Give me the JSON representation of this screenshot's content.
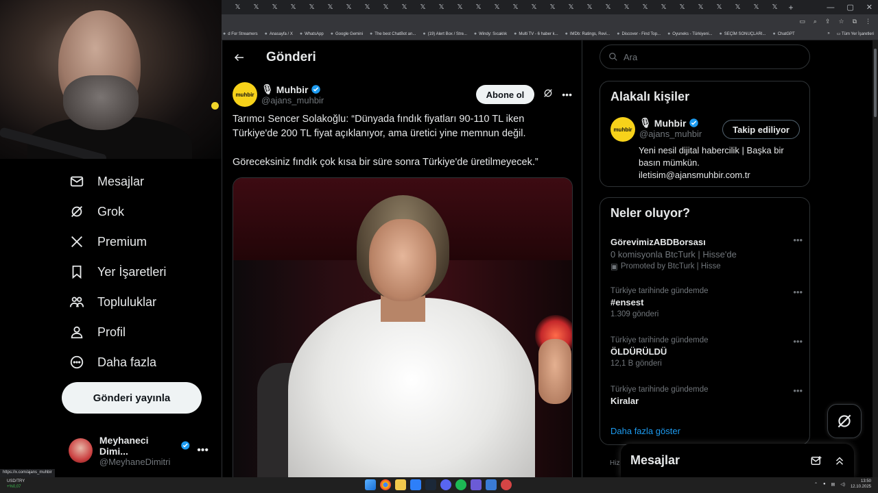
{
  "browser": {
    "tab_glyph": "𝕏",
    "new_tab": "+",
    "bookmarks": [
      "d For Streamers",
      "Anasayfa / X",
      "WhatsApp",
      "Google Gemini",
      "The best ChatBot an...",
      "(19) Alert Box / Stre...",
      "Windy: Sıcaklık",
      "Multi TV - 6 haber k...",
      "IMDb: Ratings, Revi...",
      "Discover - Find Top...",
      "Oyuneks - Türkiyeni...",
      "SEÇİM SONUÇLARI...",
      "ChatGPT"
    ],
    "bookmarks_more": "»",
    "bookmarks_all": "Tüm Yer İşaretleri",
    "status_url": "https://x.com/ajans_muhbir"
  },
  "nav": {
    "items": [
      {
        "label": "Mesajlar",
        "icon": "mail-icon"
      },
      {
        "label": "Grok",
        "icon": "grok-icon"
      },
      {
        "label": "Premium",
        "icon": "x-logo-icon"
      },
      {
        "label": "Yer İşaretleri",
        "icon": "bookmark-icon"
      },
      {
        "label": "Topluluklar",
        "icon": "communities-icon"
      },
      {
        "label": "Profil",
        "icon": "profile-icon"
      },
      {
        "label": "Daha fazla",
        "icon": "more-circle-icon"
      }
    ],
    "post_button": "Gönderi yayınla",
    "account": {
      "name": "Meyhaneci Dimi...",
      "handle": "@MeyhaneDimitri",
      "more": "•••"
    }
  },
  "main": {
    "title": "Gönderi",
    "tweet": {
      "avatar_text": "muhbir",
      "name": "Muhbir",
      "handle": "@ajans_muhbir",
      "subscribe": "Abone ol",
      "more": "•••",
      "paragraphs": [
        "Tarımcı Sencer Solakoğlu: “Dünyada fındık fiyatları 90-110 TL iken Türkiye'de 200 TL fiyat açıklanıyor, ama üretici yine memnun değil.",
        "Göreceksiniz fındık çok kısa bir süre sonra Türkiye'de üretilmeyecek.”"
      ]
    }
  },
  "sidebar": {
    "search_placeholder": "Ara",
    "related": {
      "title": "Alakalı kişiler",
      "name": "Muhbir",
      "avatar_text": "muhbir",
      "handle": "@ajans_muhbir",
      "follow": "Takip ediliyor",
      "bio": "Yeni nesil dijital habercilik | Başka bir basın mümkün. iletisim@ajansmuhbir.com.tr"
    },
    "trends": {
      "title": "Neler oluyor?",
      "items": [
        {
          "category": "",
          "name": "GörevimizABDBorsası",
          "sub": "0 komisyonla BtcTurk | Hisse'de",
          "promo": "Promoted by BtcTurk | Hisse",
          "count": ""
        },
        {
          "category": "Türkiye tarihinde gündemde",
          "name": "#ensest",
          "sub": "",
          "promo": "",
          "count": "1.309 gönderi"
        },
        {
          "category": "Türkiye tarihinde gündemde",
          "name": "ÖLDÜRÜLDÜ",
          "sub": "",
          "promo": "",
          "count": "12,1 B gönderi"
        },
        {
          "category": "Türkiye tarihinde gündemde",
          "name": "Kiralar",
          "sub": "",
          "promo": "",
          "count": ""
        }
      ],
      "show_more": "Daha fazla göster"
    },
    "tail_text": "Hiz"
  },
  "messages_drawer": {
    "title": "Mesajlar"
  },
  "taskbar": {
    "ticker_symbol": "USD/TRY",
    "ticker_change": "+%0,07",
    "time": "13:50",
    "date": "12.10.2025"
  },
  "colors": {
    "accent": "#1d9bf0",
    "verified": "#1d9bf0",
    "avatar_bg": "#f7d21a"
  }
}
